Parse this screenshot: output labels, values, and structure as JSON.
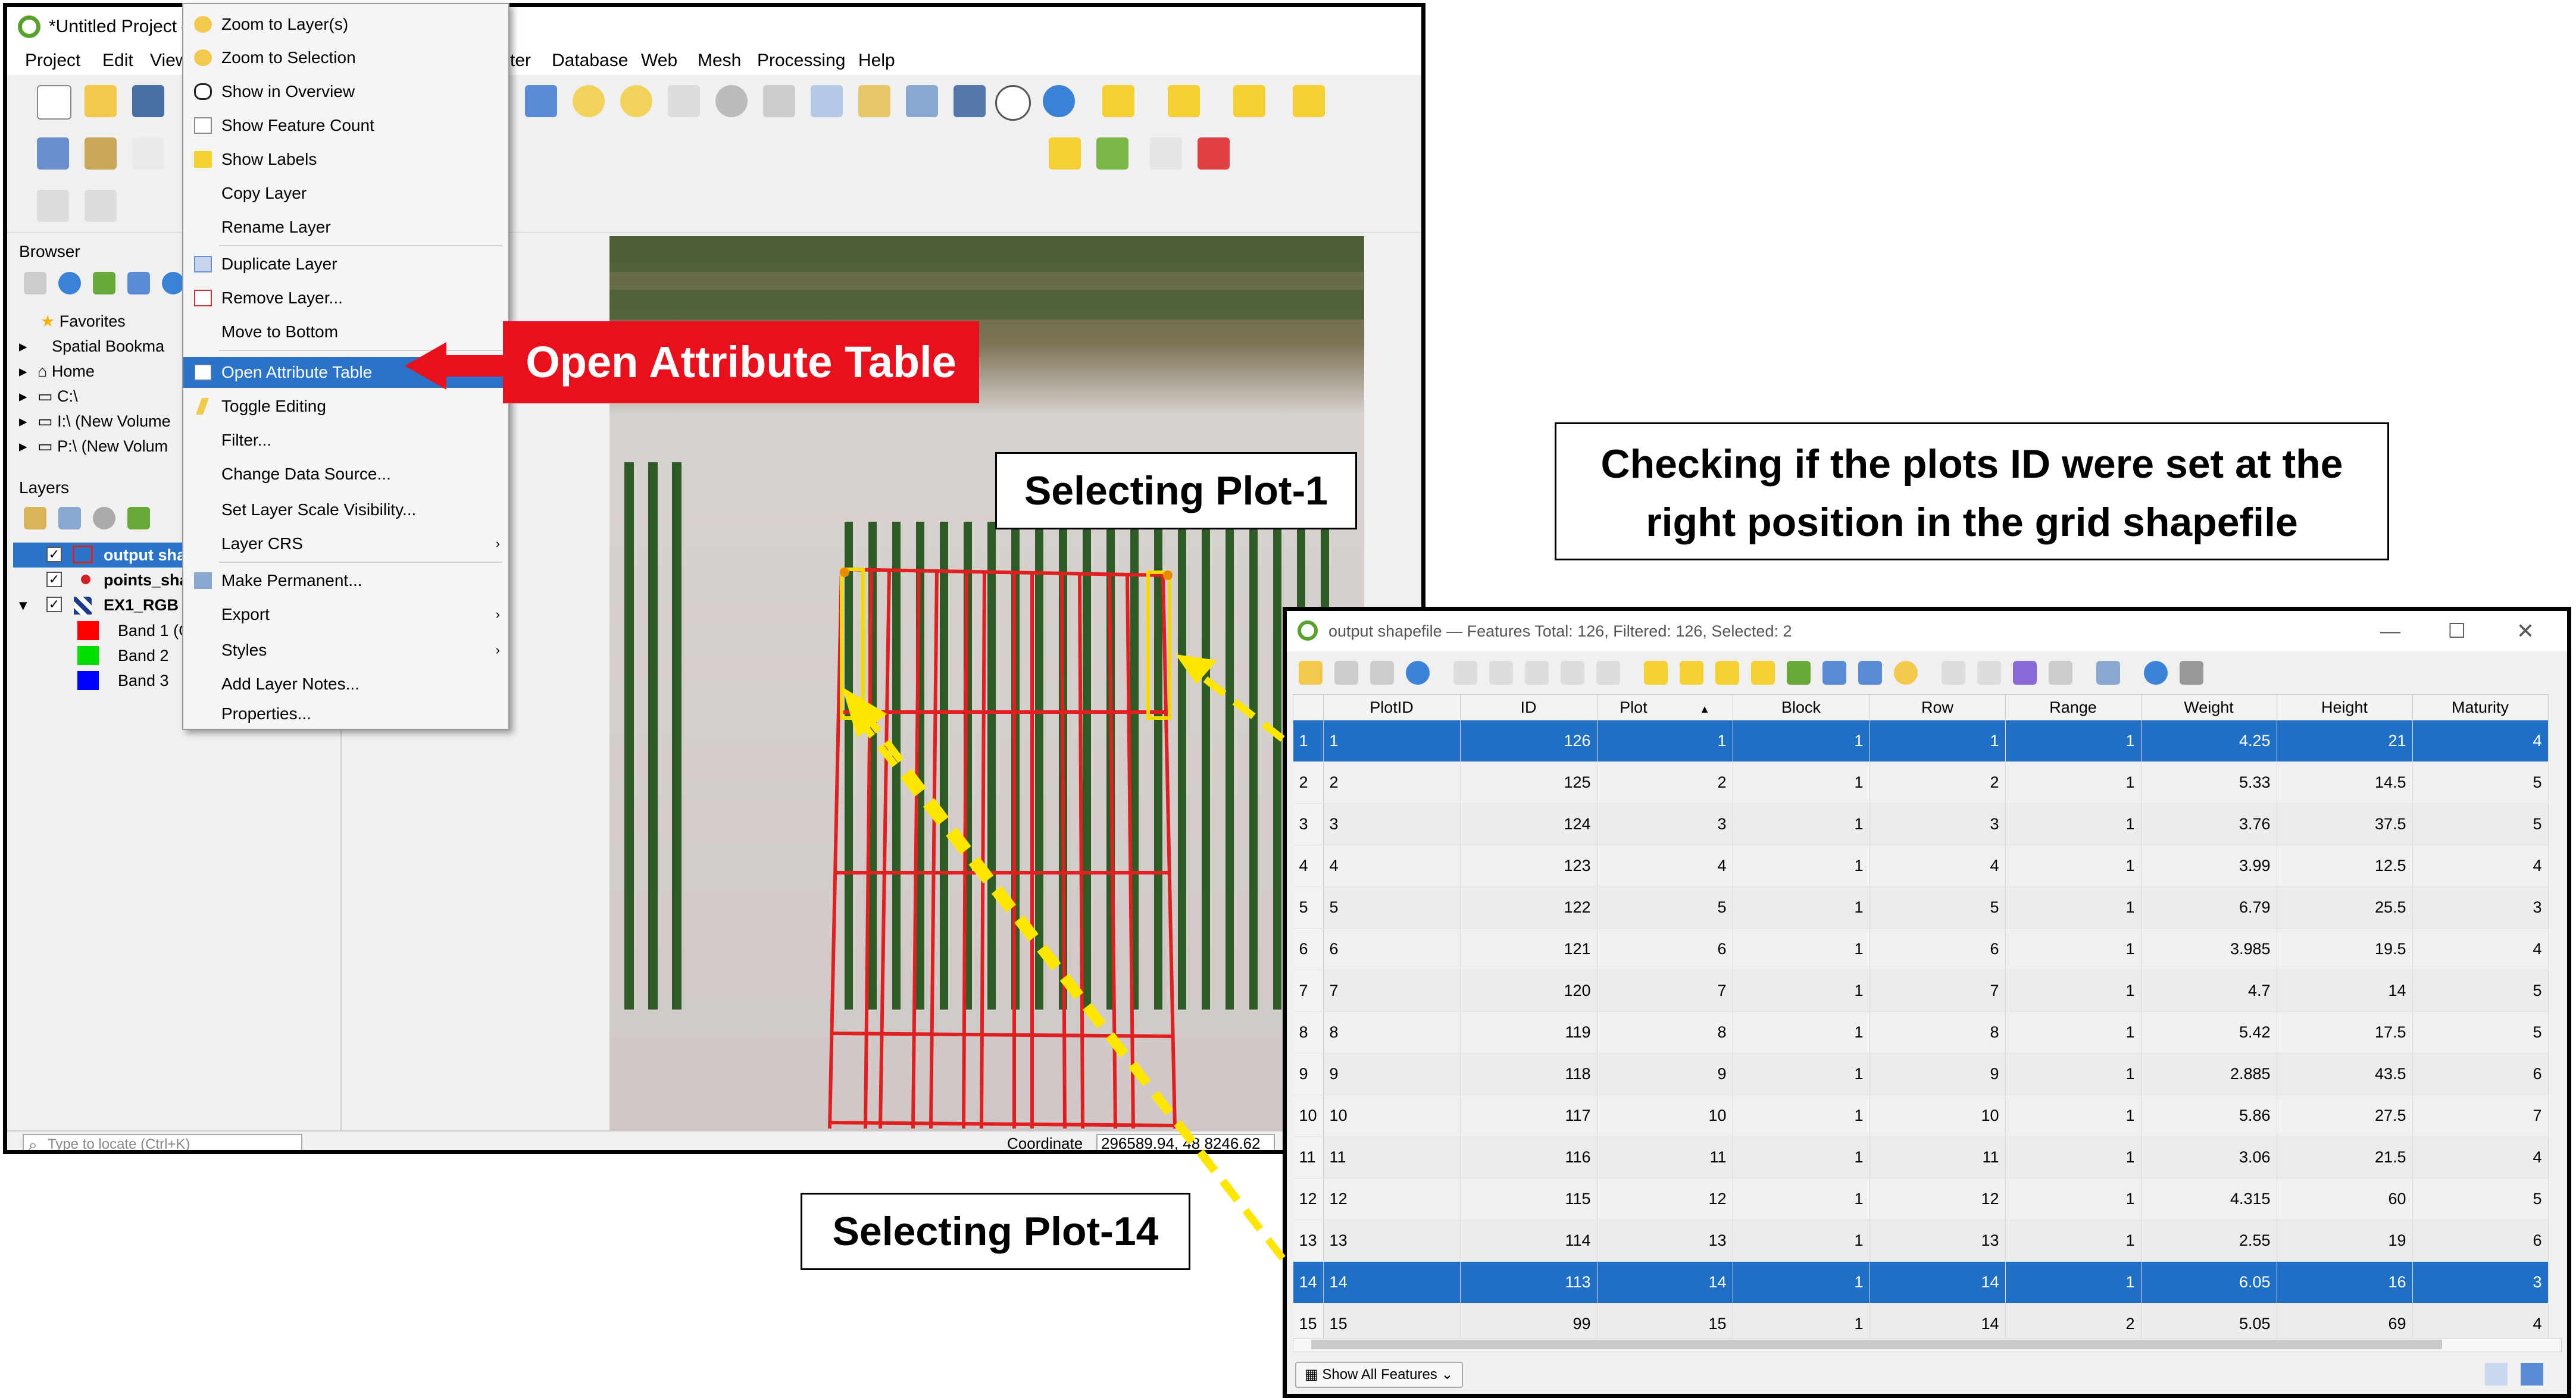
{
  "qgis": {
    "title": "*Untitled Project —",
    "menu": [
      "Project",
      "Edit",
      "View",
      "ter",
      "Database",
      "Web",
      "Mesh",
      "Processing",
      "Help"
    ],
    "browser": {
      "title": "Browser",
      "items": [
        "Favorites",
        "Spatial Bookma",
        "Home",
        "C:\\",
        "I:\\ (New Volume",
        "P:\\ (New Volum"
      ]
    },
    "layers": {
      "title": "Layers",
      "items": [
        "output sha",
        "points_sha",
        "EX1_RGB",
        "Band 1 (Gr",
        "Band 2",
        "Band 3"
      ]
    },
    "status": {
      "locate_placeholder": "Type to locate (Ctrl+K)",
      "coordinate_label": "Coordinate",
      "coordinate_value": "296589.94, 48 8246.62"
    }
  },
  "context_menu": {
    "items": [
      {
        "label": "Zoom to Layer(s)",
        "icon": "zoom-layer-icon"
      },
      {
        "label": "Zoom to Selection",
        "icon": "zoom-selection-icon"
      },
      {
        "label": "Show in Overview",
        "icon": "overview-icon"
      },
      {
        "label": "Show Feature Count",
        "icon": "checkbox-icon"
      },
      {
        "label": "Show Labels",
        "icon": "labels-icon"
      },
      {
        "label": "Copy Layer",
        "icon": ""
      },
      {
        "label": "Rename Layer",
        "icon": ""
      },
      {
        "label": "Duplicate Layer",
        "icon": "duplicate-icon"
      },
      {
        "label": "Remove Layer...",
        "icon": "remove-icon"
      },
      {
        "label": "Move to Bottom",
        "icon": ""
      },
      {
        "label": "Open Attribute Table",
        "icon": "table-icon"
      },
      {
        "label": "Toggle Editing",
        "icon": "pencil-icon"
      },
      {
        "label": "Filter...",
        "icon": ""
      },
      {
        "label": "Change Data Source...",
        "icon": ""
      },
      {
        "label": "Set Layer Scale Visibility...",
        "icon": ""
      },
      {
        "label": "Layer CRS",
        "icon": ""
      },
      {
        "label": "Make Permanent...",
        "icon": "save-icon"
      },
      {
        "label": "Export",
        "icon": ""
      },
      {
        "label": "Styles",
        "icon": ""
      },
      {
        "label": "Add Layer Notes...",
        "icon": ""
      },
      {
        "label": "Properties...",
        "icon": ""
      }
    ]
  },
  "callouts": {
    "open_attr": "Open Attribute Table",
    "plot1": "Selecting Plot-1",
    "plot14": "Selecting Plot-14",
    "checking_line1": "Checking if the plots ID were set at the",
    "checking_line2": "right position in the grid shapefile"
  },
  "attribute_table": {
    "title": "output shapefile — Features Total: 126, Filtered: 126, Selected: 2",
    "columns": [
      "PlotID",
      "ID",
      "Plot",
      "Block",
      "Row",
      "Range",
      "Weight",
      "Height",
      "Maturity"
    ],
    "rows": [
      {
        "n": "1",
        "cells": [
          "1",
          "126",
          "1",
          "1",
          "1",
          "1",
          "4.25",
          "21",
          "4"
        ],
        "selected": true
      },
      {
        "n": "2",
        "cells": [
          "2",
          "125",
          "2",
          "1",
          "2",
          "1",
          "5.33",
          "14.5",
          "5"
        ],
        "selected": false
      },
      {
        "n": "3",
        "cells": [
          "3",
          "124",
          "3",
          "1",
          "3",
          "1",
          "3.76",
          "37.5",
          "5"
        ],
        "selected": false
      },
      {
        "n": "4",
        "cells": [
          "4",
          "123",
          "4",
          "1",
          "4",
          "1",
          "3.99",
          "12.5",
          "4"
        ],
        "selected": false
      },
      {
        "n": "5",
        "cells": [
          "5",
          "122",
          "5",
          "1",
          "5",
          "1",
          "6.79",
          "25.5",
          "3"
        ],
        "selected": false
      },
      {
        "n": "6",
        "cells": [
          "6",
          "121",
          "6",
          "1",
          "6",
          "1",
          "3.985",
          "19.5",
          "4"
        ],
        "selected": false
      },
      {
        "n": "7",
        "cells": [
          "7",
          "120",
          "7",
          "1",
          "7",
          "1",
          "4.7",
          "14",
          "5"
        ],
        "selected": false
      },
      {
        "n": "8",
        "cells": [
          "8",
          "119",
          "8",
          "1",
          "8",
          "1",
          "5.42",
          "17.5",
          "5"
        ],
        "selected": false
      },
      {
        "n": "9",
        "cells": [
          "9",
          "118",
          "9",
          "1",
          "9",
          "1",
          "2.885",
          "43.5",
          "6"
        ],
        "selected": false
      },
      {
        "n": "10",
        "cells": [
          "10",
          "117",
          "10",
          "1",
          "10",
          "1",
          "5.86",
          "27.5",
          "7"
        ],
        "selected": false
      },
      {
        "n": "11",
        "cells": [
          "11",
          "116",
          "11",
          "1",
          "11",
          "1",
          "3.06",
          "21.5",
          "4"
        ],
        "selected": false
      },
      {
        "n": "12",
        "cells": [
          "12",
          "115",
          "12",
          "1",
          "12",
          "1",
          "4.315",
          "60",
          "5"
        ],
        "selected": false
      },
      {
        "n": "13",
        "cells": [
          "13",
          "114",
          "13",
          "1",
          "13",
          "1",
          "2.55",
          "19",
          "6"
        ],
        "selected": false
      },
      {
        "n": "14",
        "cells": [
          "14",
          "113",
          "14",
          "1",
          "14",
          "1",
          "6.05",
          "16",
          "3"
        ],
        "selected": true
      },
      {
        "n": "15",
        "cells": [
          "15",
          "99",
          "15",
          "1",
          "14",
          "2",
          "5.05",
          "69",
          "4"
        ],
        "selected": false
      }
    ],
    "show_all": "Show All Features"
  },
  "colors": {
    "selection": "#1f6fc5",
    "callout_red": "#e8101c",
    "grid_red": "#e02020",
    "arrow_yellow": "#ffe600"
  }
}
